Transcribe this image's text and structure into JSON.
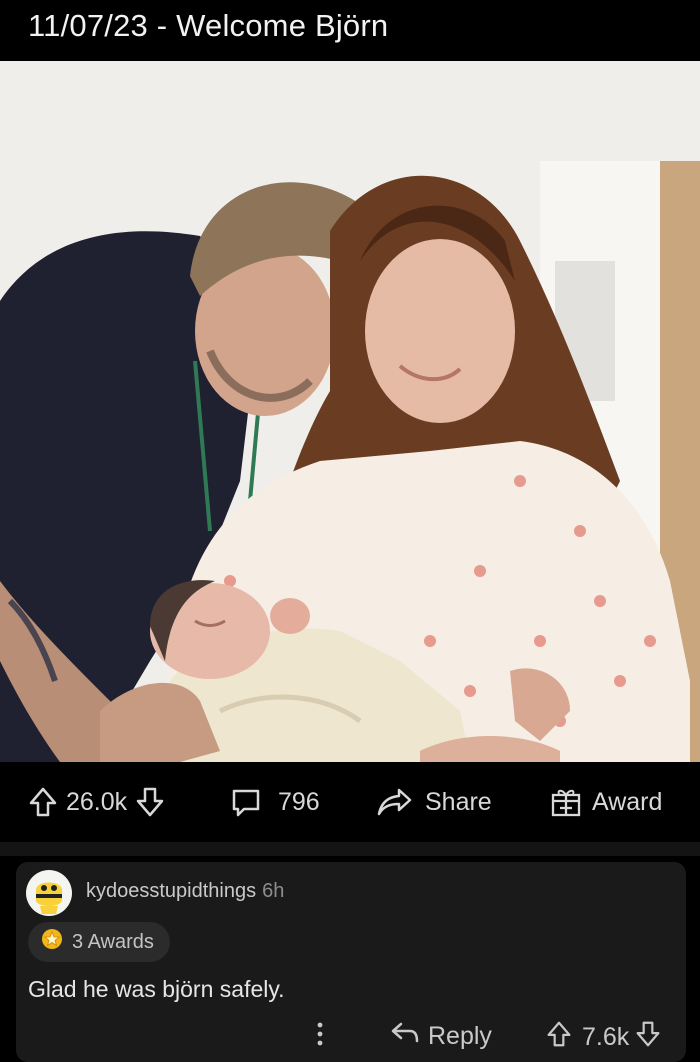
{
  "post": {
    "title": "11/07/23 - Welcome Björn"
  },
  "actions": {
    "upvotes": "26.0k",
    "comments": "796",
    "share_label": "Share",
    "award_label": "Award"
  },
  "comment": {
    "author": "kydoesstupidthings",
    "time": "6h",
    "awards": "3 Awards",
    "body": "Glad he was björn safely.",
    "reply_label": "Reply",
    "votes": "7.6k"
  },
  "colors": {
    "background": "#000000",
    "comment_card": "#1a1a1a",
    "award_pill": "#2b2b2b",
    "award_gold": "#f2b619"
  },
  "icons": [
    "upvote-arrow-icon",
    "downvote-arrow-icon",
    "comment-bubble-icon",
    "share-arrow-icon",
    "award-gift-icon",
    "award-badge-icon",
    "more-dots-icon",
    "reply-arrow-icon"
  ]
}
